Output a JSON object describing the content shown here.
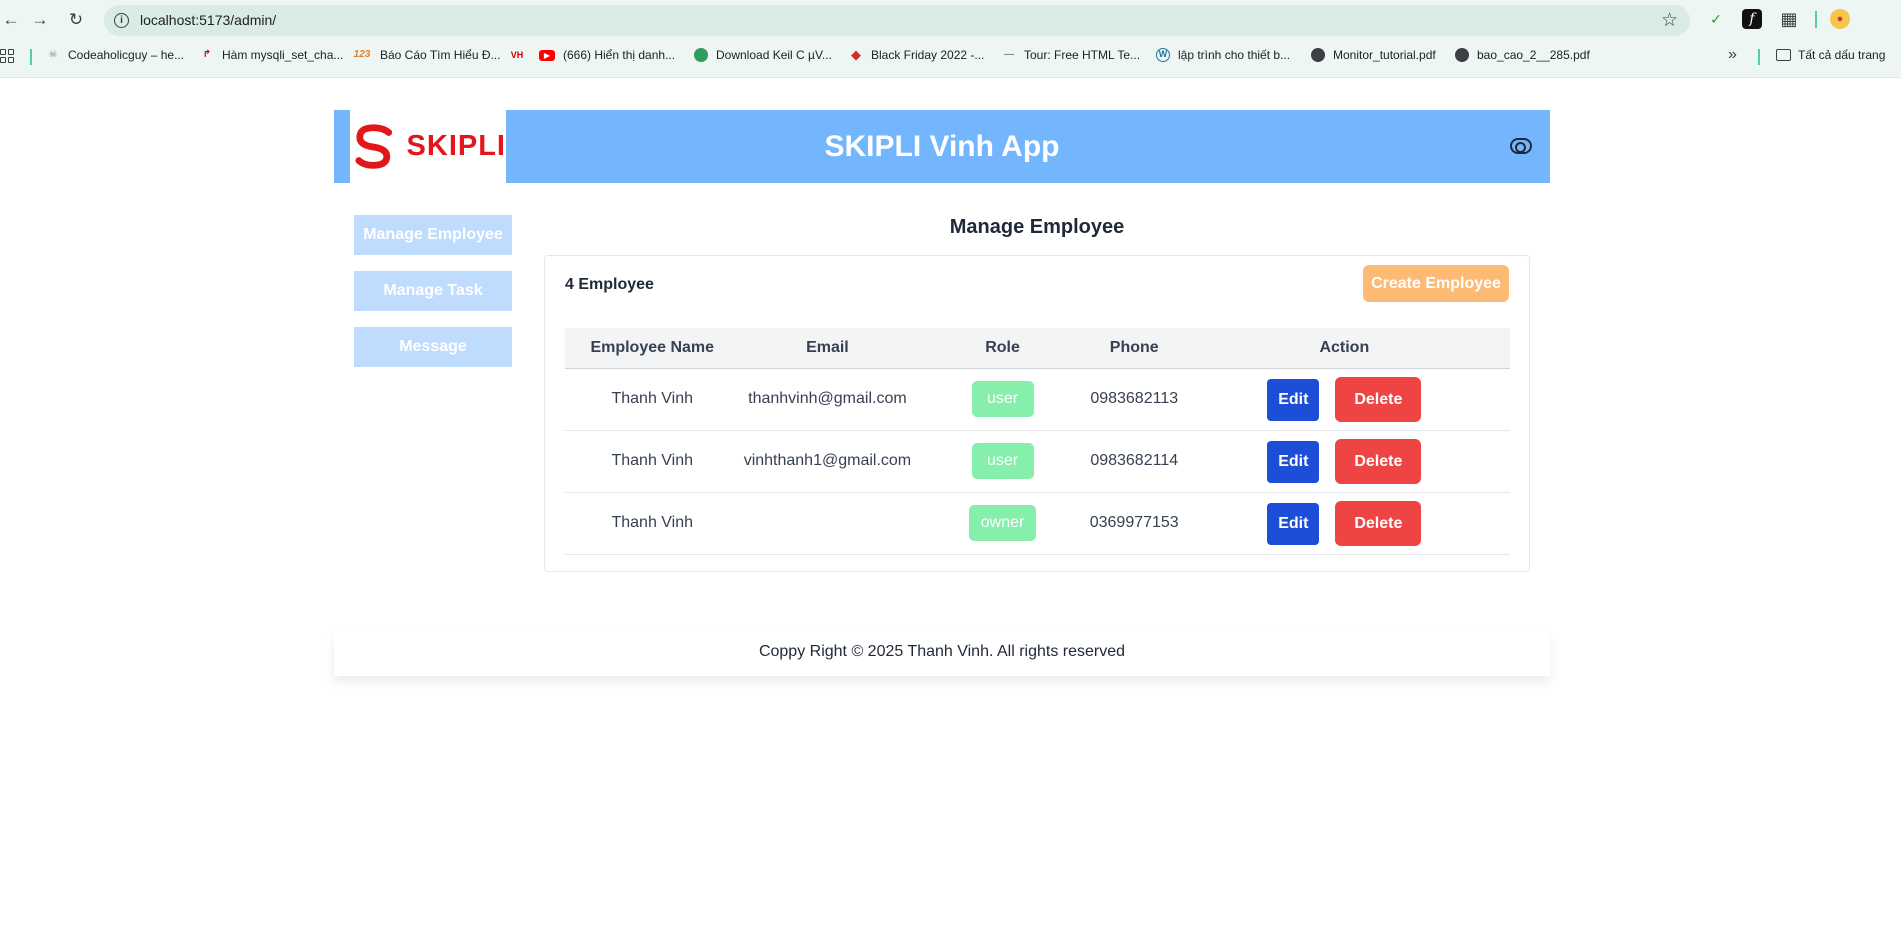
{
  "browser": {
    "url": "localhost:5173/admin/",
    "bookmarks": [
      {
        "label": "Codeaholicguy – he...",
        "icon": "skull-icon"
      },
      {
        "label": "Hàm mysqli_set_cha...",
        "icon": "redirect-arrow-icon"
      },
      {
        "label": "Báo Cáo Tìm Hiểu Đ...",
        "icon": "123-icon"
      },
      {
        "label": "",
        "icon": "vnh-logo-icon"
      },
      {
        "label": "(666) Hiển thị danh...",
        "icon": "youtube-icon"
      },
      {
        "label": "Download Keil C µV...",
        "icon": "green-circle-icon"
      },
      {
        "label": "Black Friday 2022 -...",
        "icon": "red-diamond-icon"
      },
      {
        "label": "Tour: Free HTML Te...",
        "icon": "dash-icon"
      },
      {
        "label": "lập trình cho thiết b...",
        "icon": "wordpress-icon"
      },
      {
        "label": "Monitor_tutorial.pdf",
        "icon": "globe-icon"
      },
      {
        "label": "bao_cao_2__285.pdf",
        "icon": "globe-icon"
      }
    ],
    "all_bookmarks_label": "Tất cả dấu trang"
  },
  "header": {
    "logo_text": "SKIPLI",
    "app_title": "SKIPLI Vinh App"
  },
  "sidebar": {
    "items": [
      {
        "label": "Manage Employee"
      },
      {
        "label": "Manage Task"
      },
      {
        "label": "Message"
      }
    ]
  },
  "main": {
    "title": "Manage Employee",
    "count_label": "4 Employee",
    "create_button": "Create Employee",
    "columns": [
      "Employee Name",
      "Email",
      "Role",
      "Phone",
      "Action"
    ],
    "rows": [
      {
        "name": "Thanh Vinh",
        "email": "thanhvinh@gmail.com",
        "role": "user",
        "phone": "0983682113"
      },
      {
        "name": "Thanh Vinh",
        "email": "vinhthanh1@gmail.com",
        "role": "user",
        "phone": "0983682114"
      },
      {
        "name": "Thanh Vinh",
        "email": "",
        "role": "owner",
        "phone": "0369977153"
      }
    ],
    "edit_label": "Edit",
    "delete_label": "Delete"
  },
  "footer": {
    "text": "Coppy Right © 2025 Thanh Vinh. All rights reserved"
  },
  "colors": {
    "header_bg": "#74b6fd",
    "logo_red": "#e3161b",
    "sidebar_btn": "#bfdbfe",
    "create_btn": "#fdba74",
    "role_badge": "#86efac",
    "edit_btn": "#1d4ed8",
    "delete_btn": "#ef4444"
  }
}
